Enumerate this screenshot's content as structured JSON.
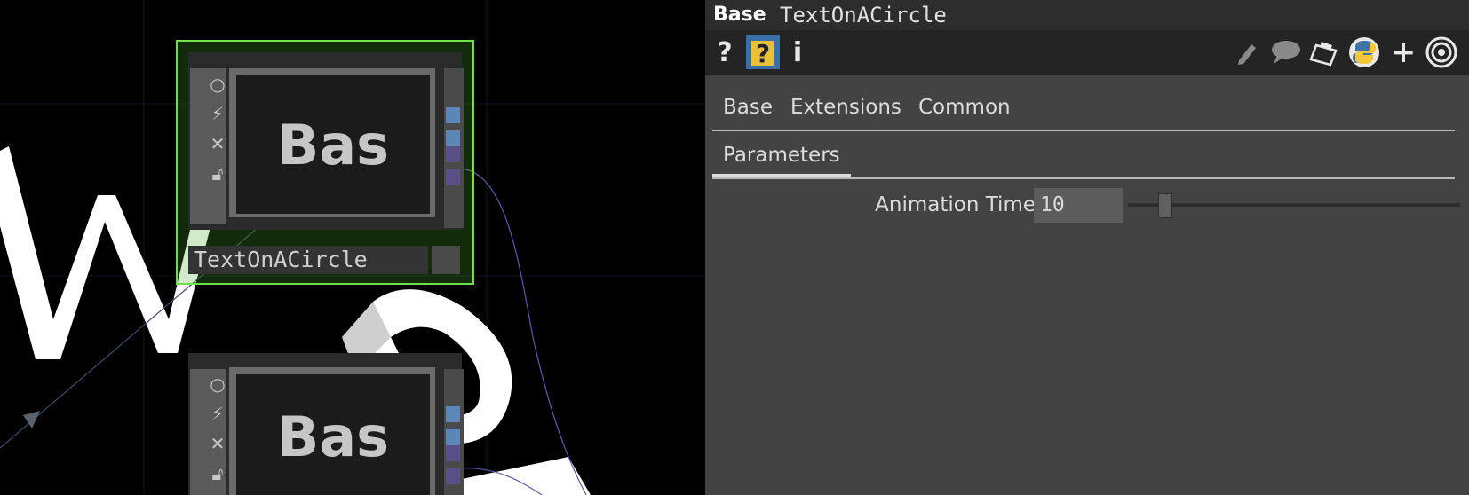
{
  "network": {
    "node1": {
      "viewer_text": "Bas",
      "name": "TextOnACircle",
      "selected": true
    },
    "node2": {
      "viewer_text": "Bas"
    },
    "flags": [
      "circle-icon",
      "bypass-icon",
      "close-icon",
      "lock-icon"
    ]
  },
  "panel": {
    "op_type": "Base",
    "op_name": "TextOnACircle",
    "toolbar_left": [
      "help-icon",
      "operator-help-icon",
      "info-icon"
    ],
    "toolbar_right": [
      "edit-icon",
      "comment-icon",
      "clipboard-icon",
      "python-icon",
      "add-icon",
      "target-icon"
    ],
    "tabs": [
      "Base",
      "Extensions",
      "Common"
    ],
    "subtabs": [
      "Parameters"
    ],
    "params": [
      {
        "label": "Animation Time",
        "value": "10",
        "slider_fraction": 0.1
      }
    ]
  },
  "colors": {
    "selection": "#6fe24a",
    "panel_bg": "#434343",
    "port_blue": "#5a86b8",
    "port_purple": "#5c4f88"
  }
}
